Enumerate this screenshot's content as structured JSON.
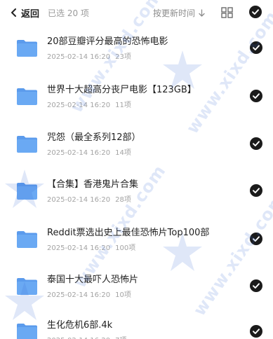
{
  "header": {
    "back_label": "返回",
    "selected_count": "已选 20 项",
    "sort_label": "按更新时间",
    "back_icon": "chevron-left-icon",
    "sort_icon": "arrow-down-icon",
    "grid_icon": "grid-view-icon",
    "select_all_icon": "checkmark-circle-icon"
  },
  "watermark": {
    "text": "www.xixd.com"
  },
  "colors": {
    "folder": "#6aa9f3",
    "folder_back": "#5b9bec",
    "check_fill": "#1b1b1b",
    "watermark": "#3f6fd6"
  },
  "files": [
    {
      "name": "20部豆瓣评分最高的恐怖电影",
      "date": "2025-02-14 16:20",
      "count": "23项",
      "selected": true
    },
    {
      "name": "世界十大超高分丧尸电影【123GB】",
      "date": "2025-02-14 16:20",
      "count": "11项",
      "selected": true
    },
    {
      "name": "咒怨（最全系列12部）",
      "date": "2025-02-14 16:20",
      "count": "14项",
      "selected": true
    },
    {
      "name": "【合集】香港鬼片合集",
      "date": "2025-02-14 16:20",
      "count": "28项",
      "selected": true
    },
    {
      "name": "Reddit票选出史上最佳恐怖片Top100部",
      "date": "2025-02-14 16:20",
      "count": "100项",
      "selected": true
    },
    {
      "name": "泰国十大最吓人恐怖片",
      "date": "2025-02-14 16:20",
      "count": "10项",
      "selected": true
    },
    {
      "name": "生化危机6部.4k",
      "date": "2025-02-14 16:20",
      "count": "7项",
      "selected": true
    }
  ]
}
